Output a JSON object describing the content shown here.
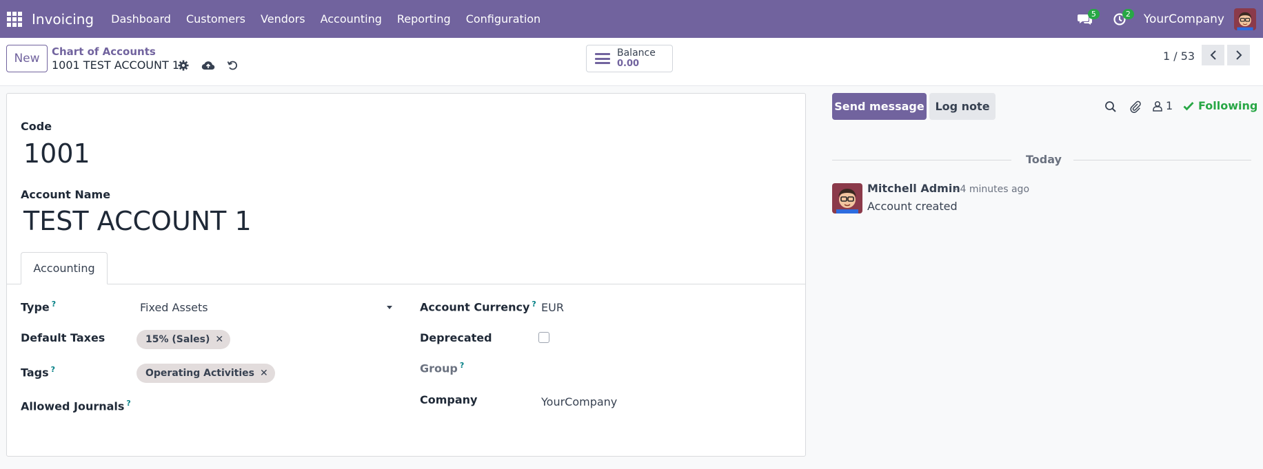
{
  "navbar": {
    "app_name": "Invoicing",
    "menu": [
      "Dashboard",
      "Customers",
      "Vendors",
      "Accounting",
      "Reporting",
      "Configuration"
    ],
    "messages_count": "5",
    "activities_count": "2",
    "company": "YourCompany",
    "bg_color": "#71639e"
  },
  "control_panel": {
    "new_label": "New",
    "breadcrumb_parent": "Chart of Accounts",
    "breadcrumb_current": "1001 TEST ACCOUNT 1",
    "smart_button": {
      "label": "Balance",
      "value": "0.00"
    },
    "pager": "1 / 53"
  },
  "form": {
    "code_label": "Code",
    "code_value": "1001",
    "name_label": "Account Name",
    "name_value": "TEST ACCOUNT 1",
    "tab_label": "Accounting",
    "help_mark": "?",
    "type_label": "Type",
    "type_value": "Fixed Assets",
    "default_taxes_label": "Default Taxes",
    "default_taxes_tag": "15% (Sales)",
    "tags_label": "Tags",
    "tags_tag": "Operating Activities",
    "allowed_journals_label": "Allowed Journals",
    "currency_label": "Account Currency",
    "currency_value": "EUR",
    "deprecated_label": "Deprecated",
    "deprecated_checked": false,
    "group_label": "Group",
    "company_label": "Company",
    "company_value": "YourCompany",
    "tag_remove": "✕"
  },
  "chatter": {
    "send_message_label": "Send message",
    "log_note_label": "Log note",
    "followers_count": "1",
    "following_label": "Following",
    "date_separator": "Today",
    "message": {
      "author": "Mitchell Admin",
      "time": "- 4 minutes ago",
      "body": "Account created"
    }
  }
}
